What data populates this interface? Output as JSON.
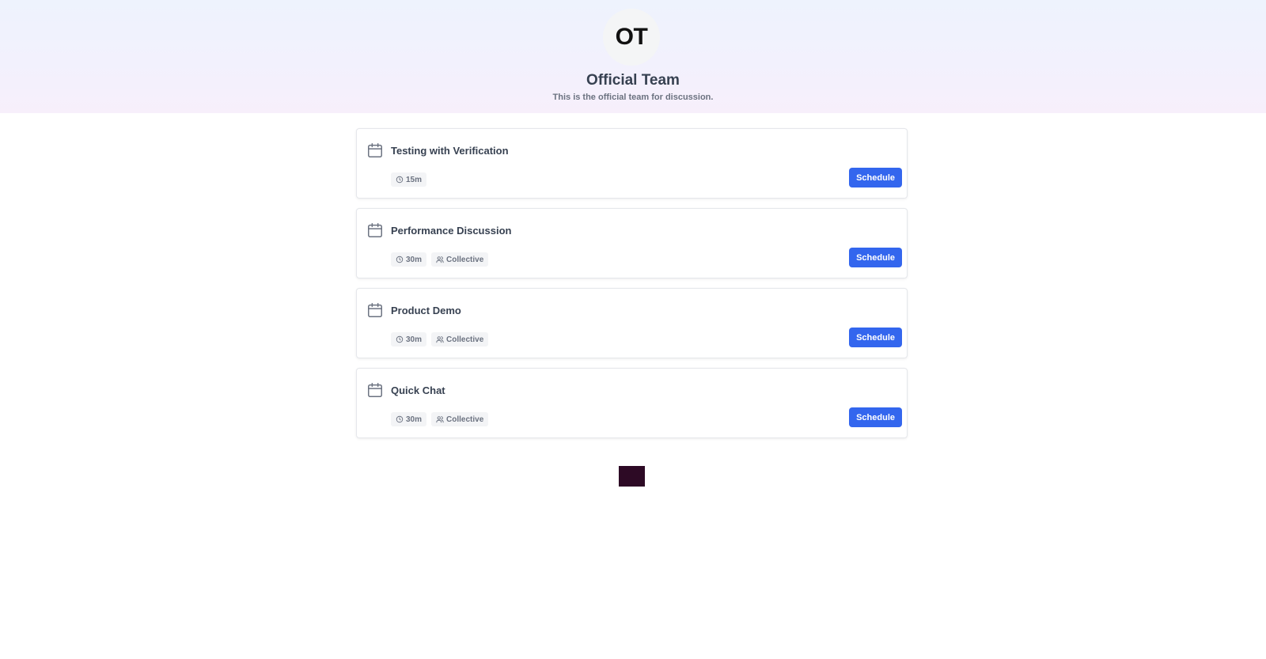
{
  "team": {
    "initials": "OT",
    "name": "Official Team",
    "description": "This is the official team for discussion."
  },
  "events": [
    {
      "title": "Testing with Verification",
      "duration": "15m",
      "type": "",
      "button": "Schedule"
    },
    {
      "title": "Performance Discussion",
      "duration": "30m",
      "type": "Collective",
      "button": "Schedule"
    },
    {
      "title": "Product Demo",
      "duration": "30m",
      "type": "Collective",
      "button": "Schedule"
    },
    {
      "title": "Quick Chat",
      "duration": "30m",
      "type": "Collective",
      "button": "Schedule"
    }
  ],
  "colors": {
    "primary_button": "#3366ee",
    "footer_block": "#2d0a25"
  },
  "icons": {
    "event": "calendar-icon",
    "duration": "clock-icon",
    "type": "users-icon"
  }
}
